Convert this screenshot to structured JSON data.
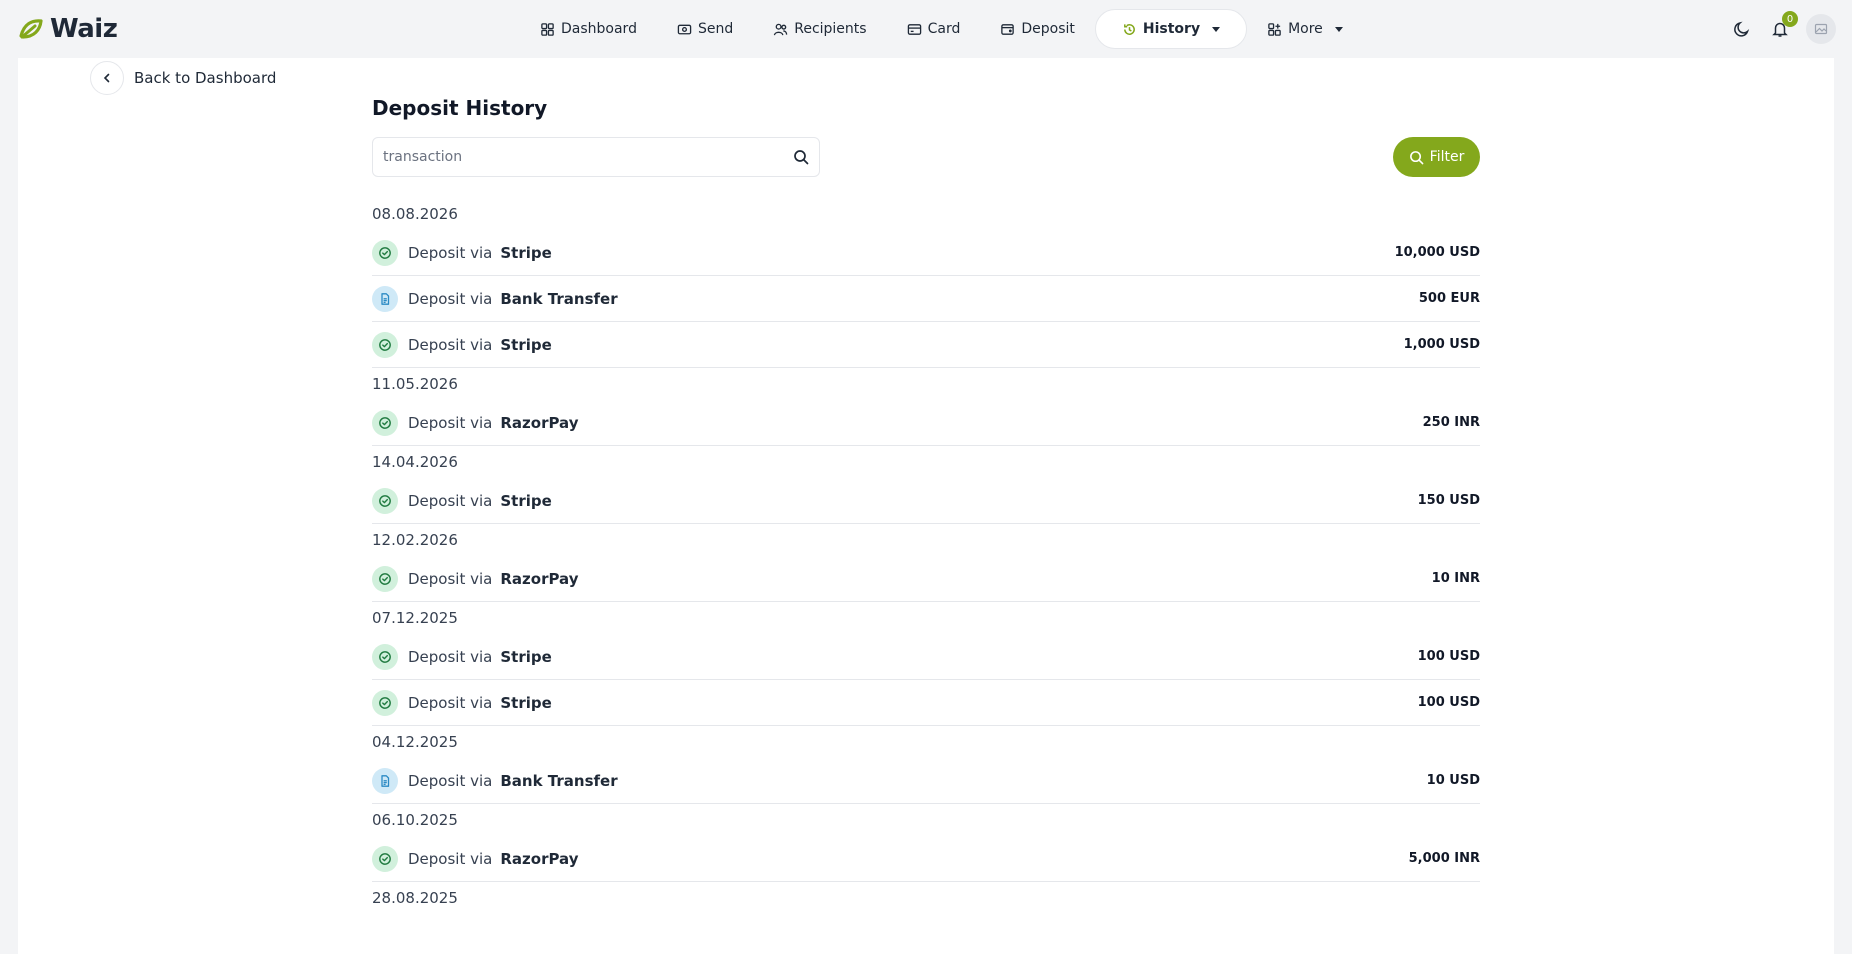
{
  "brand": {
    "name": "Waiz"
  },
  "nav": {
    "items": [
      {
        "label": "Dashboard",
        "icon": "grid-icon"
      },
      {
        "label": "Send",
        "icon": "money-icon"
      },
      {
        "label": "Recipients",
        "icon": "users-icon"
      },
      {
        "label": "Card",
        "icon": "card-icon"
      },
      {
        "label": "Deposit",
        "icon": "wallet-icon"
      },
      {
        "label": "History",
        "icon": "history-icon",
        "active": true
      },
      {
        "label": "More",
        "icon": "apps-icon"
      }
    ]
  },
  "header": {
    "notifications_count": "0"
  },
  "back": {
    "label": "Back to Dashboard"
  },
  "page": {
    "title": "Deposit History"
  },
  "search": {
    "placeholder": "transaction"
  },
  "filter": {
    "label": "Filter"
  },
  "colors": {
    "accent": "#84a81c",
    "success_bg": "#d1f0dc",
    "pending_bg": "#cfe9f7"
  },
  "groups": [
    {
      "date": "08.08.2026",
      "items": [
        {
          "prefix": "Deposit via",
          "method": "Stripe",
          "amount": "10,000 USD",
          "status": "completed"
        },
        {
          "prefix": "Deposit via",
          "method": "Bank Transfer",
          "amount": "500 EUR",
          "status": "pending"
        },
        {
          "prefix": "Deposit via",
          "method": "Stripe",
          "amount": "1,000 USD",
          "status": "completed"
        }
      ]
    },
    {
      "date": "11.05.2026",
      "items": [
        {
          "prefix": "Deposit via",
          "method": "RazorPay",
          "amount": "250 INR",
          "status": "completed"
        }
      ]
    },
    {
      "date": "14.04.2026",
      "items": [
        {
          "prefix": "Deposit via",
          "method": "Stripe",
          "amount": "150 USD",
          "status": "completed"
        }
      ]
    },
    {
      "date": "12.02.2026",
      "items": [
        {
          "prefix": "Deposit via",
          "method": "RazorPay",
          "amount": "10 INR",
          "status": "completed"
        }
      ]
    },
    {
      "date": "07.12.2025",
      "items": [
        {
          "prefix": "Deposit via",
          "method": "Stripe",
          "amount": "100 USD",
          "status": "completed"
        },
        {
          "prefix": "Deposit via",
          "method": "Stripe",
          "amount": "100 USD",
          "status": "completed"
        }
      ]
    },
    {
      "date": "04.12.2025",
      "items": [
        {
          "prefix": "Deposit via",
          "method": "Bank Transfer",
          "amount": "10 USD",
          "status": "pending"
        }
      ]
    },
    {
      "date": "06.10.2025",
      "items": [
        {
          "prefix": "Deposit via",
          "method": "RazorPay",
          "amount": "5,000 INR",
          "status": "completed"
        }
      ]
    },
    {
      "date": "28.08.2025",
      "items": []
    }
  ]
}
